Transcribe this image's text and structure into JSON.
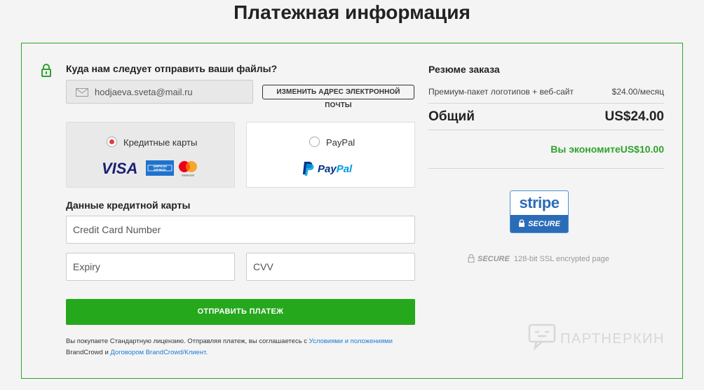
{
  "page_title": "Платежная информация",
  "delivery": {
    "heading": "Куда нам следует отправить ваши файлы?",
    "email_value": "hodjaeva.sveta@mail.ru",
    "change_email_label": "ИЗМЕНИТЬ АДРЕС ЭЛЕКТРОННОЙ ПОЧТЫ"
  },
  "payment_methods": {
    "credit_card_label": "Кредитные карты",
    "credit_card_selected": true,
    "visa_logo": "VISA",
    "amex_logo": "AMERICAN EXPRESS",
    "mastercard_logo": "mastercard",
    "paypal_label": "PayPal",
    "paypal_logo": "PayPal"
  },
  "card_details": {
    "heading": "Данные кредитной карты",
    "card_number_placeholder": "Credit Card Number",
    "expiry_placeholder": "Expiry",
    "cvv_placeholder": "CVV"
  },
  "submit_label": "ОТПРАВИТЬ ПЛАТЕЖ",
  "legal": {
    "text_1": "Вы покупаете Стандартную лицензию. Отправляя платеж, вы соглашаетесь с ",
    "terms_link": "Условиями и положениями",
    "text_2": "BrandCrowd и ",
    "agreement_link": "Договором BrandCrowd/Клиент",
    "text_3": "."
  },
  "summary": {
    "heading": "Резюме заказа",
    "item_label": "Премиум-пакет логотипов + веб-сайт",
    "item_price": "$24.00/месяц",
    "total_label": "Общий",
    "total_value": "US$24.00",
    "savings_text": "Вы экономитеUS$10.00"
  },
  "stripe_badge": {
    "brand": "stripe",
    "secure": "SECURE"
  },
  "ssl": {
    "secure": "SECURE",
    "text": "128-bit SSL encrypted page"
  },
  "watermark": "ПАРТНЕРКИН",
  "colors": {
    "accent_green": "#25a81c",
    "border_green": "#2ea32a",
    "radio_red": "#e33b3b",
    "link_blue": "#1a7bd6",
    "stripe_blue": "#2b6cb7"
  }
}
